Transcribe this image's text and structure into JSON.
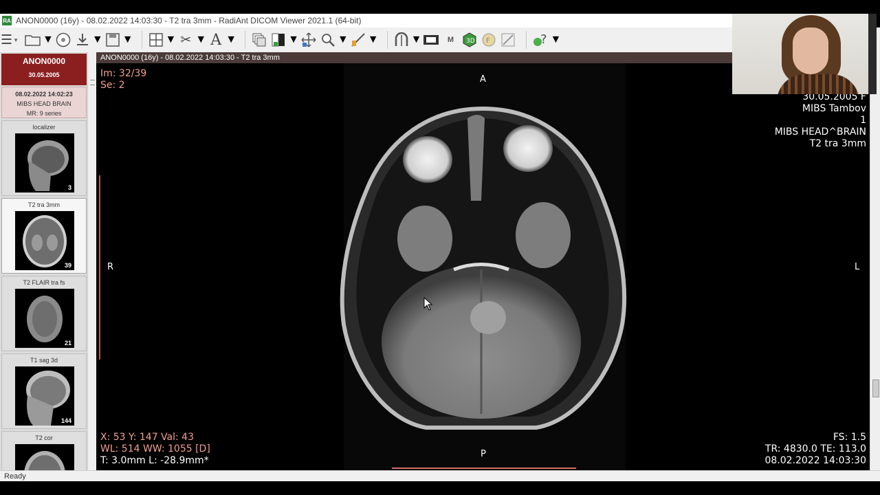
{
  "window": {
    "title": "ANON0000  (16y) - 08.02.2022 14:03:30 - T2 tra 3mm - RadiAnt DICOM Viewer 2021.1 (64-bit)",
    "icon_text": "RA"
  },
  "toolbar": {
    "icons": [
      "menu-icon",
      "open-folder-icon",
      "cd-dvd-icon",
      "download-icon",
      "save-icon",
      "layout-grid-icon",
      "scissors-cut-icon",
      "text-annotation-icon",
      "series-stack-icon",
      "window-level-icon",
      "pan-icon",
      "zoom-icon",
      "measure-ruler-icon",
      "scroll-link-icon",
      "film-export-icon",
      "mpr-icon",
      "3d-volume-icon",
      "fusion-icon",
      "compare-icon",
      "help-icon"
    ]
  },
  "sidebar": {
    "patient": {
      "name": "ANON0000",
      "dob": "30.05.2005"
    },
    "study": {
      "datetime": "08.02.2022 14:02:23",
      "description": "MIBS HEAD BRAIN",
      "modality": "MR: 9 series"
    },
    "series": [
      {
        "label": "localizer",
        "count": "3",
        "selected": false
      },
      {
        "label": "T2 tra 3mm",
        "count": "39",
        "selected": true
      },
      {
        "label": "T2 FLAIR tra fs",
        "count": "21",
        "selected": false
      },
      {
        "label": "T1 sag 3d",
        "count": "144",
        "selected": false
      },
      {
        "label": "T2 cor",
        "count": "",
        "selected": false
      }
    ]
  },
  "viewport": {
    "header": "ANON0000  (16y) - 08.02.2022 14:03:30 - T2 tra 3mm",
    "top_left": {
      "image": "Im: 32/39",
      "series": "Se: 2"
    },
    "top_right": {
      "dob_sex": "30.05.2005 F",
      "institution": "MIBS Tambov",
      "number": "1",
      "study": "MIBS HEAD^BRAIN",
      "series": "T2 tra 3mm"
    },
    "orientation": {
      "top": "A",
      "bottom": "P",
      "left": "R",
      "right": "L"
    },
    "bottom_left": {
      "coords": "X: 53 Y: 147 Val: 43",
      "window": "WL: 514 WW: 1055 [D]",
      "thickness": "T: 3.0mm L: -28.9mm*"
    },
    "bottom_right": {
      "fs": "FS: 1.5",
      "tr_te": "TR: 4830.0 TE: 113.0",
      "datetime": "08.02.2022 14:03:30"
    }
  },
  "statusbar": {
    "text": "Ready"
  },
  "colors": {
    "accent_header": "#4a3b39",
    "patient_bg": "#8b1f1f",
    "overlay_salmon": "#f0a090"
  }
}
